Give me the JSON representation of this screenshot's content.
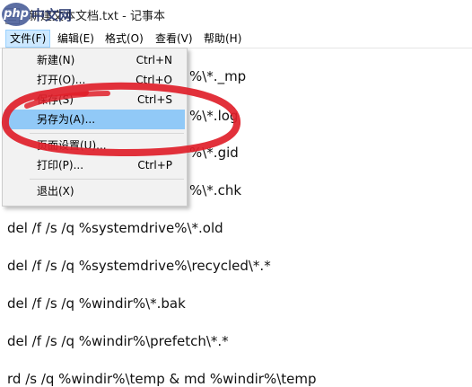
{
  "window": {
    "title": "新建文本文档.txt - 记事本",
    "watermark_logo": "php",
    "watermark_text": "中文网"
  },
  "menubar": [
    {
      "label": "文件(F)"
    },
    {
      "label": "编辑(E)"
    },
    {
      "label": "格式(O)"
    },
    {
      "label": "查看(V)"
    },
    {
      "label": "帮助(H)"
    }
  ],
  "file_menu": [
    {
      "label": "新建(N)",
      "shortcut": "Ctrl+N"
    },
    {
      "label": "打开(O)...",
      "shortcut": "Ctrl+O"
    },
    {
      "label": "保存(S)",
      "shortcut": "Ctrl+S"
    },
    {
      "label": "另存为(A)...",
      "shortcut": ""
    },
    {
      "label": "页面设置(U)...",
      "shortcut": ""
    },
    {
      "label": "打印(P)...",
      "shortcut": "Ctrl+P"
    },
    {
      "label": "退出(X)",
      "shortcut": ""
    }
  ],
  "editor_lines": [
    "%\\*._mp",
    "%\\*.log",
    "%\\*.gid",
    "%\\*.chk",
    "del /f /s /q %systemdrive%\\*.old",
    "del /f /s /q %systemdrive%\\recycled\\*.*",
    "del /f /s /q %windir%\\*.bak",
    "del /f /s /q %windir%\\prefetch\\*.*",
    "rd /s /q %windir%\\temp & md %windir%\\temp"
  ],
  "colors": {
    "menu_active_bg": "#cce8ff",
    "menu_hover_bg": "#91c9f7",
    "annotation_red": "#e0202a"
  }
}
